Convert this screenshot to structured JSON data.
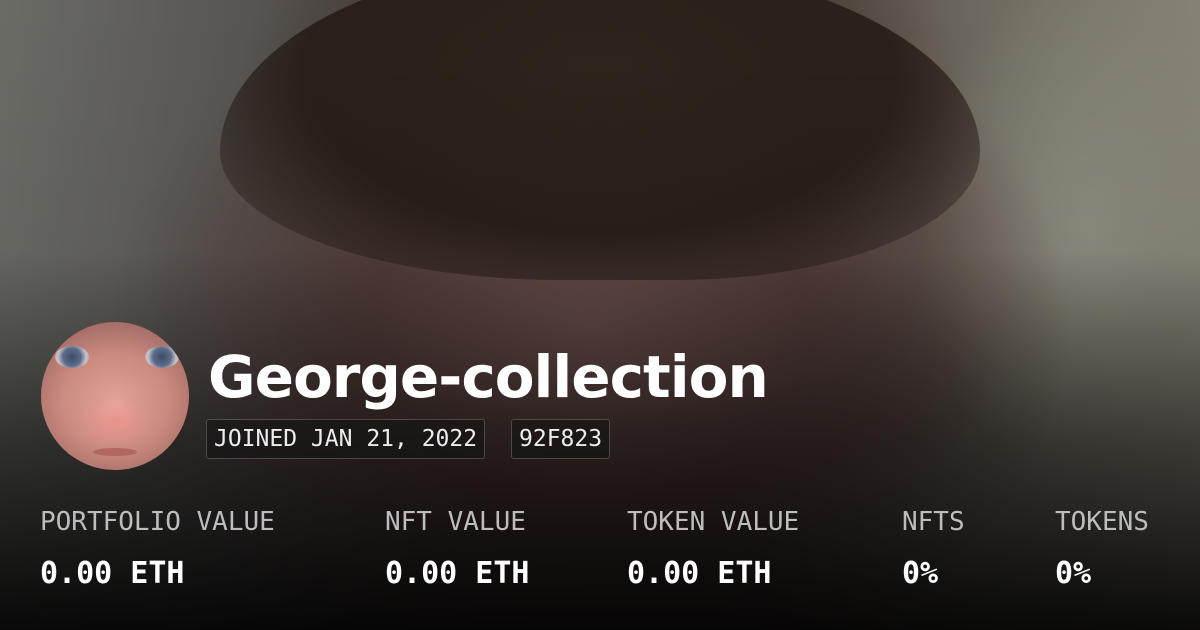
{
  "profile": {
    "name": "George-collection",
    "joined": "JOINED JAN 21, 2022",
    "address_short": "92F823"
  },
  "stats": [
    {
      "label": "PORTFOLIO VALUE",
      "value": "0.00 ETH"
    },
    {
      "label": "NFT VALUE",
      "value": "0.00 ETH"
    },
    {
      "label": "TOKEN VALUE",
      "value": "0.00 ETH"
    },
    {
      "label": "NFTS",
      "value": "0%"
    },
    {
      "label": "TOKENS",
      "value": "0%"
    }
  ]
}
